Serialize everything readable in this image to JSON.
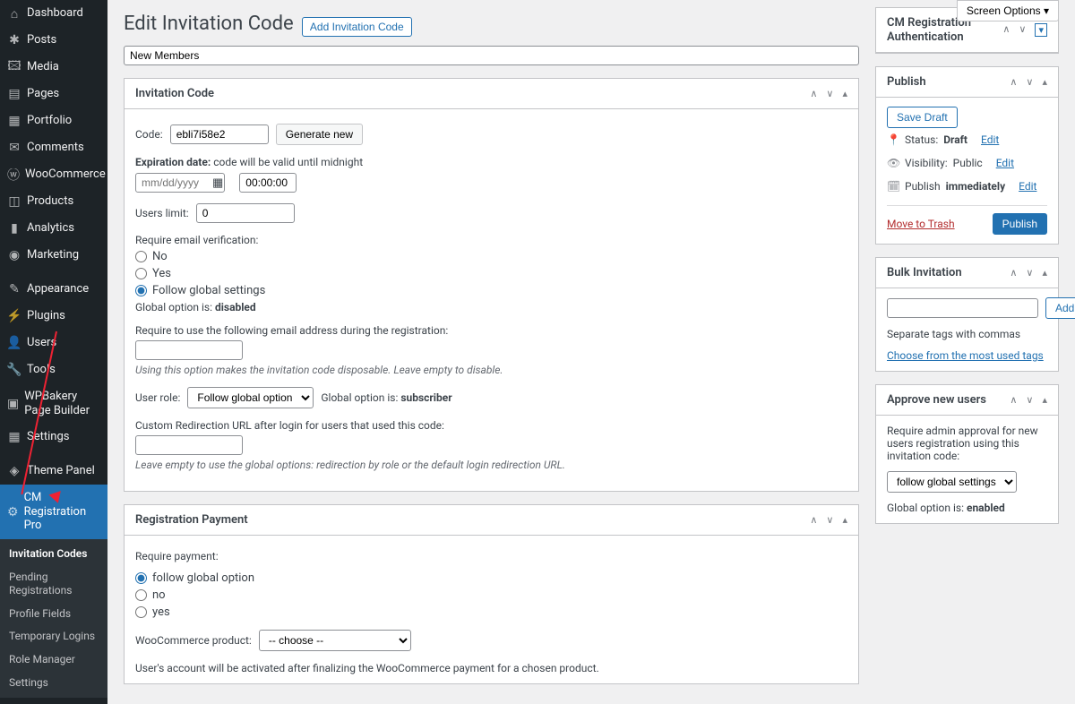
{
  "screen_options": "Screen Options ▾",
  "sidebar": {
    "items": [
      {
        "icon": "🏠",
        "label": "Dashboard"
      },
      {
        "icon": "📌",
        "label": "Posts"
      },
      {
        "icon": "🖼",
        "label": "Media"
      },
      {
        "icon": "📄",
        "label": "Pages"
      },
      {
        "icon": "🗂",
        "label": "Portfolio"
      },
      {
        "icon": "💬",
        "label": "Comments"
      },
      {
        "icon": "🛒",
        "label": "WooCommerce"
      },
      {
        "icon": "📦",
        "label": "Products"
      },
      {
        "icon": "📊",
        "label": "Analytics"
      },
      {
        "icon": "📣",
        "label": "Marketing"
      },
      {
        "icon": "🎨",
        "label": "Appearance"
      },
      {
        "icon": "🔌",
        "label": "Plugins"
      },
      {
        "icon": "👥",
        "label": "Users"
      },
      {
        "icon": "🔧",
        "label": "Tools"
      },
      {
        "icon": "🧱",
        "label": "WPBakery Page Builder"
      },
      {
        "icon": "⚙",
        "label": "Settings"
      },
      {
        "icon": "◈",
        "label": "Theme Panel"
      },
      {
        "icon": "⚙",
        "label": "CM Registration Pro"
      }
    ],
    "sub": [
      "Invitation Codes",
      "Pending Registrations",
      "Profile Fields",
      "Temporary Logins",
      "Role Manager",
      "Settings"
    ]
  },
  "page": {
    "title": "Edit Invitation Code",
    "add_btn": "Add Invitation Code",
    "post_title": "New Members"
  },
  "box_invitation": {
    "title": "Invitation Code",
    "code_label": "Code:",
    "code_value": "ebli7i58e2",
    "generate_btn": "Generate new",
    "exp_label": "Expiration date:",
    "exp_hint": "code will be valid until midnight",
    "exp_date_placeholder": "mm/dd/yyyy",
    "exp_time": "00:00:00",
    "users_limit_label": "Users limit:",
    "users_limit_value": "0",
    "rev_label": "Require email verification:",
    "rev_opts": [
      "No",
      "Yes",
      "Follow global settings"
    ],
    "rev_global": "Global option is: ",
    "rev_global_val": "disabled",
    "email_req_label": "Require to use the following email address during the registration:",
    "email_req_hint": "Using this option makes the invitation code disposable. Leave empty to disable.",
    "role_label": "User role:",
    "role_select": "Follow global option",
    "role_global": "Global option is: ",
    "role_global_val": "subscriber",
    "redir_label": "Custom Redirection URL after login for users that used this code:",
    "redir_hint": "Leave empty to use the global options: redirection by role or the default login redirection URL."
  },
  "box_payment": {
    "title": "Registration Payment",
    "req_label": "Require payment:",
    "opts": [
      "follow global option",
      "no",
      "yes"
    ],
    "woo_label": "WooCommerce product:",
    "woo_select": "-- choose --",
    "hint": "User's account will be activated after finalizing the WooCommerce payment for a chosen product."
  },
  "side": {
    "auth_title": "CM Registration Authentication",
    "publish": {
      "title": "Publish",
      "save_draft": "Save Draft",
      "status_label": "Status: ",
      "status_val": "Draft",
      "edit": "Edit",
      "vis_label": "Visibility: ",
      "vis_val": "Public",
      "pub_label": "Publish ",
      "pub_val": "immediately",
      "trash": "Move to Trash",
      "publish_btn": "Publish"
    },
    "bulk": {
      "title": "Bulk Invitation",
      "add": "Add",
      "hint": "Separate tags with commas",
      "choose": "Choose from the most used tags"
    },
    "approve": {
      "title": "Approve new users",
      "desc": "Require admin approval for new users registration using this invitation code:",
      "select": "follow global settings",
      "global": "Global option is: ",
      "global_val": "enabled"
    }
  }
}
